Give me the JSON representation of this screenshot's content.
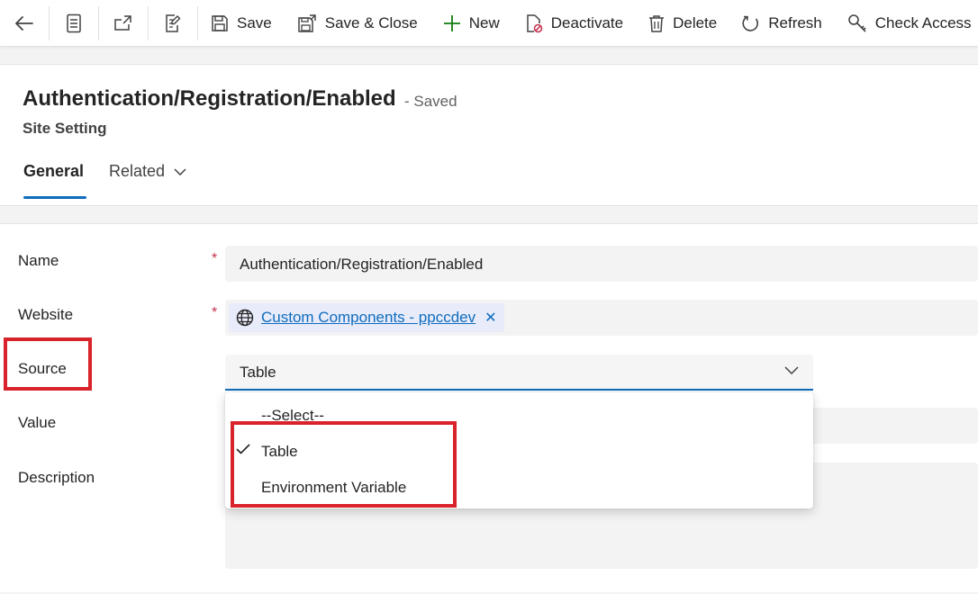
{
  "toolbar": {
    "back_icon": "arrow-left-icon",
    "form_icon": "form-icon",
    "open_new_window_icon": "open-in-new-window-icon",
    "edit_form_icon": "edit-form-icon",
    "save": "Save",
    "save_close": "Save & Close",
    "new": "New",
    "deactivate": "Deactivate",
    "delete": "Delete",
    "refresh": "Refresh",
    "check_access": "Check Access"
  },
  "header": {
    "title": "Authentication/Registration/Enabled",
    "status": "- Saved",
    "entity": "Site Setting",
    "tabs": [
      {
        "label": "General",
        "selected": true
      },
      {
        "label": "Related",
        "selected": false
      }
    ]
  },
  "form": {
    "name": {
      "label": "Name",
      "required_mark": "*",
      "value": "Authentication/Registration/Enabled"
    },
    "website": {
      "label": "Website",
      "required_mark": "*",
      "value": "Custom Components - ppccdev",
      "icon": "globe-icon"
    },
    "source": {
      "label": "Source",
      "value": "Table"
    },
    "value_field": {
      "label": "Value"
    },
    "description": {
      "label": "Description"
    }
  },
  "dropdown": {
    "options": [
      {
        "label": "--Select--",
        "selected": false
      },
      {
        "label": "Table",
        "selected": true
      },
      {
        "label": "Environment Variable",
        "selected": false
      }
    ]
  },
  "colors": {
    "accent": "#0f6cbd",
    "highlight": "#d9232a",
    "required": "#c4314b",
    "add_icon": "#107c10"
  }
}
